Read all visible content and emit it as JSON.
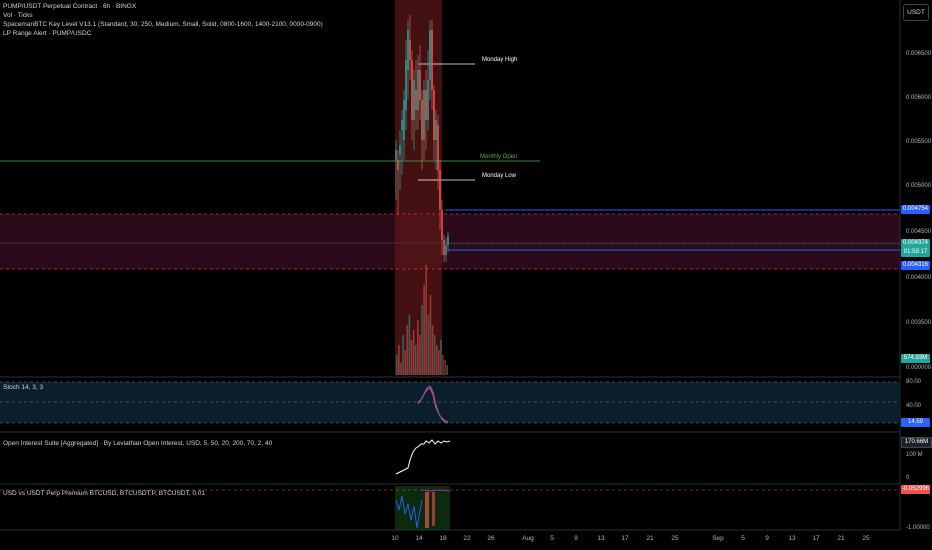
{
  "legend": {
    "symbol": "PUMP/USDT Perpetual Contract · 6h · BINGX",
    "line2": "Vol · Ticks",
    "line3": "SpacemanBTC Key Level V13.1 (Standard, 30, 250, Medium, Small, Solid, 0800-1600, 1400-2100, 0000-0900)",
    "line4": "LP Range Alert · PUMP/USDC"
  },
  "currency_button": "USDT",
  "price_axis": [
    "0.006500",
    "0.006000",
    "0.005500",
    "0.005000",
    "0.004500",
    "0.004000",
    "0.003500",
    "0.000000"
  ],
  "price_tags": {
    "upper": "0.004754",
    "current": "0.004374",
    "countdown": "01:59:17",
    "lower": "0.004316",
    "volume": "574.93M"
  },
  "annotations": {
    "monday_high": "Monday High",
    "monthly_open": "Monthly Open",
    "monday_low": "Monday Low"
  },
  "stoch": {
    "label": "Stoch 14, 3, 3",
    "ticks": [
      "80.00",
      "40.00"
    ],
    "value": "14.59"
  },
  "oi": {
    "label": "Open Interest Suite [Aggregated] · By Leviathan Open Interest, USD, 5, 50, 20, 200, 70, 2, 40",
    "value": "170.66M",
    "ticks": [
      "100 M",
      "0"
    ]
  },
  "premium": {
    "label": "USD vs USDT Perp Premium BTCUSD, BTCUSDT.P, BTCUSDT, 0.01",
    "value": "-0.052996",
    "ticks": [
      "-1.00000"
    ]
  },
  "time_axis": [
    "10",
    "14",
    "18",
    "22",
    "26",
    "Aug",
    "5",
    "9",
    "13",
    "17",
    "21",
    "25",
    "Sep",
    "5",
    "9",
    "13",
    "17",
    "21",
    "25"
  ],
  "colors": {
    "up": "#26a69a",
    "down": "#ef5350",
    "monthly_open": "#4caf50",
    "blue_level": "#2962ff",
    "zone": "#e91e63",
    "stoch_k": "#7e57c2",
    "stoch_d": "#ef5350"
  }
}
